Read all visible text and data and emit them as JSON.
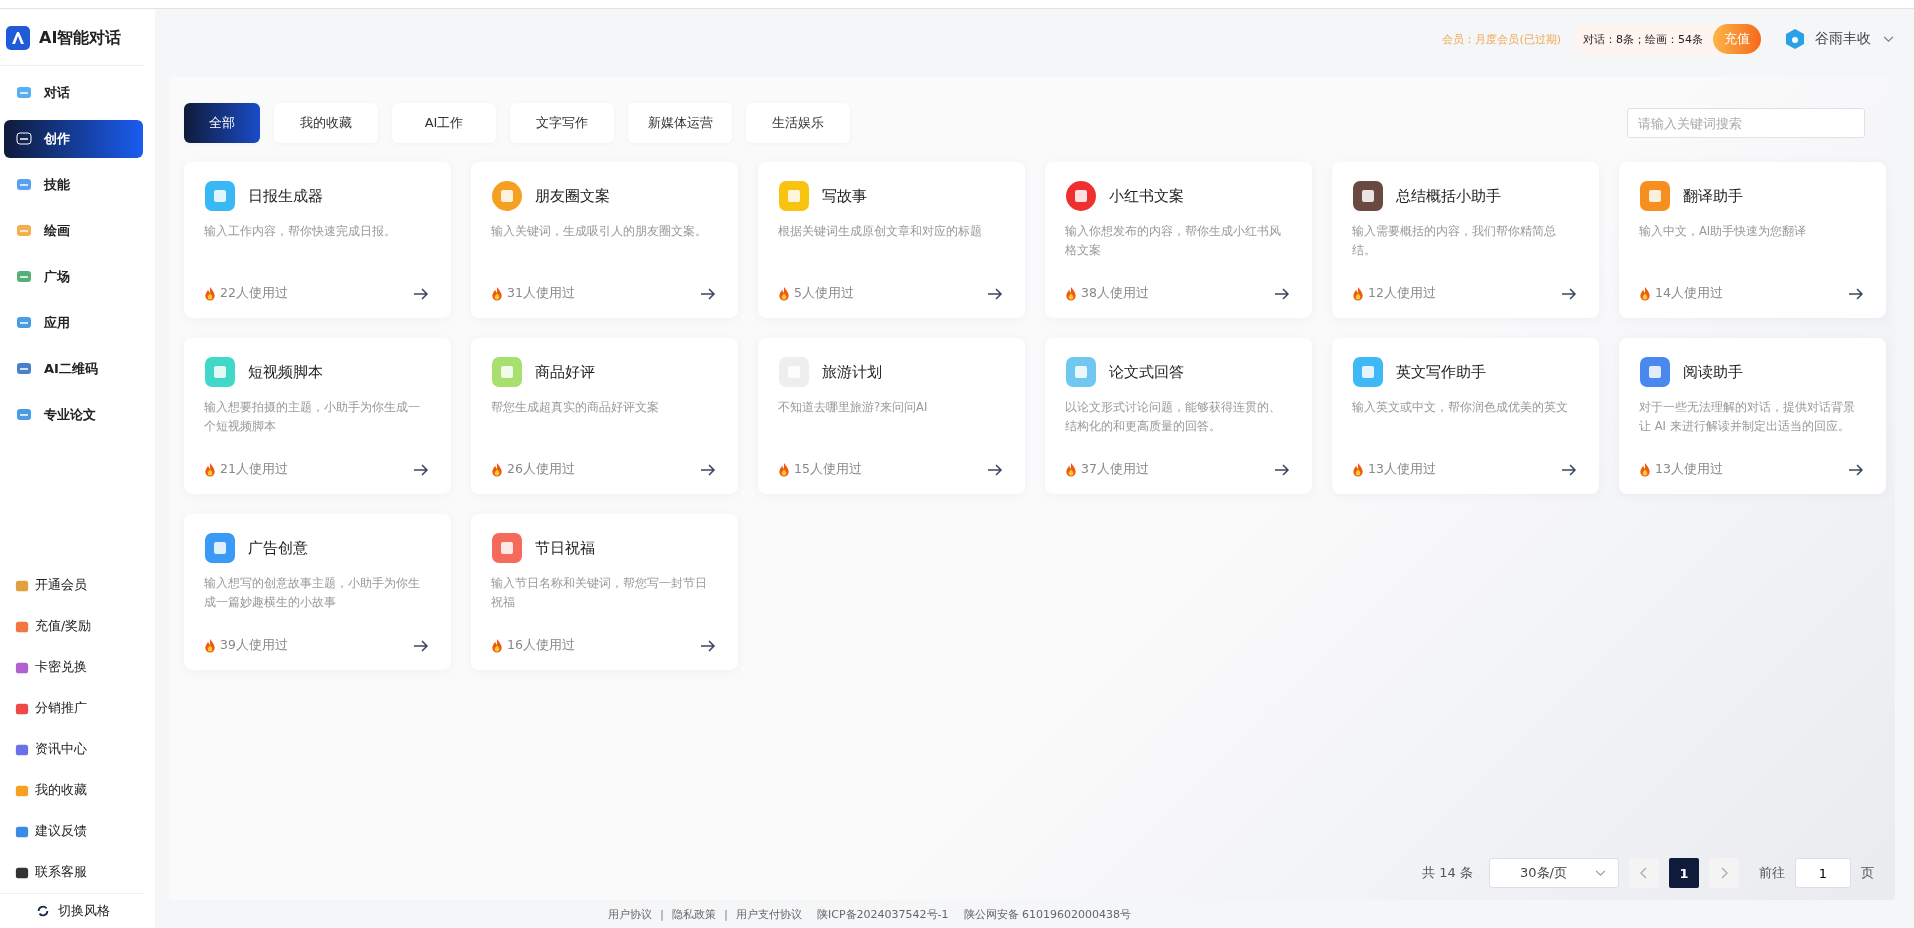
{
  "app": {
    "title": "AI智能对话"
  },
  "sidebar": {
    "items": [
      {
        "label": "对话",
        "selected": false
      },
      {
        "label": "创作",
        "selected": true
      },
      {
        "label": "技能",
        "selected": false
      },
      {
        "label": "绘画",
        "selected": false
      },
      {
        "label": "广场",
        "selected": false
      },
      {
        "label": "应用",
        "selected": false
      },
      {
        "label": "AI二维码",
        "selected": false
      },
      {
        "label": "专业论文",
        "selected": false
      }
    ],
    "bottom_items": [
      "开通会员",
      "充值/奖励",
      "卡密兑换",
      "分销推广",
      "资讯中心",
      "我的收藏",
      "建议反馈",
      "联系客服"
    ],
    "switch_style": "切换风格"
  },
  "header": {
    "membership": "会员：月度会员(已过期)",
    "quota": "对话：8条；绘画：54条",
    "recharge_button": "充值",
    "user_name": "谷雨丰收"
  },
  "tabs": [
    {
      "label": "全部",
      "selected": true
    },
    {
      "label": "我的收藏",
      "selected": false
    },
    {
      "label": "AI工作",
      "selected": false
    },
    {
      "label": "文字写作",
      "selected": false
    },
    {
      "label": "新媒体运营",
      "selected": false
    },
    {
      "label": "生活娱乐",
      "selected": false
    }
  ],
  "search": {
    "placeholder": "请输入关键词搜索"
  },
  "cards": [
    {
      "title": "日报生成器",
      "description": "输入工作内容，帮你快速完成日报。",
      "usage": "22人使用过"
    },
    {
      "title": "朋友圈文案",
      "description": "输入关键词，生成吸引人的朋友圈文案。",
      "usage": "31人使用过"
    },
    {
      "title": "写故事",
      "description": "根据关键词生成原创文章和对应的标题",
      "usage": "5人使用过"
    },
    {
      "title": "小红书文案",
      "description": "输入你想发布的内容，帮你生成小红书风格文案",
      "usage": "38人使用过"
    },
    {
      "title": "总结概括小助手",
      "description": "输入需要概括的内容，我们帮你精简总结。",
      "usage": "12人使用过"
    },
    {
      "title": "翻译助手",
      "description": "输入中文，AI助手快速为您翻译",
      "usage": "14人使用过"
    },
    {
      "title": "短视频脚本",
      "description": "输入想要拍摄的主题，小助手为你生成一个短视频脚本",
      "usage": "21人使用过"
    },
    {
      "title": "商品好评",
      "description": "帮您生成超真实的商品好评文案",
      "usage": "26人使用过"
    },
    {
      "title": "旅游计划",
      "description": "不知道去哪里旅游?来问问AI",
      "usage": "15人使用过"
    },
    {
      "title": "论文式回答",
      "description": "以论文形式讨论问题，能够获得连贯的、结构化的和更高质量的回答。",
      "usage": "37人使用过"
    },
    {
      "title": "英文写作助手",
      "description": "输入英文或中文，帮你润色成优美的英文",
      "usage": "13人使用过"
    },
    {
      "title": "阅读助手",
      "description": "对于一些无法理解的对话，提供对话背景让 AI 来进行解读并制定出适当的回应。",
      "usage": "13人使用过"
    },
    {
      "title": "广告创意",
      "description": "输入想写的创意故事主题，小助手为你生成一篇妙趣横生的小故事",
      "usage": "39人使用过"
    },
    {
      "title": "节日祝福",
      "description": "输入节日名称和关键词，帮您写一封节日祝福",
      "usage": "16人使用过"
    }
  ],
  "pagination": {
    "total": "共 14 条",
    "page_size": "30条/页",
    "pages": [
      {
        "label": "1",
        "selected": true
      }
    ],
    "goto_label": "前往",
    "goto_value": "1",
    "goto_suffix": "页"
  },
  "footer": {
    "links": [
      {
        "kind": "link",
        "text": "用户协议"
      },
      {
        "kind": "separator",
        "text": "|"
      },
      {
        "kind": "link",
        "text": "隐私政策"
      },
      {
        "kind": "separator",
        "text": "|"
      },
      {
        "kind": "link",
        "text": "用户支付协议"
      }
    ],
    "icp": "陕ICP备2024037542号-1",
    "police": "陕公网安备 61019602000438号"
  }
}
